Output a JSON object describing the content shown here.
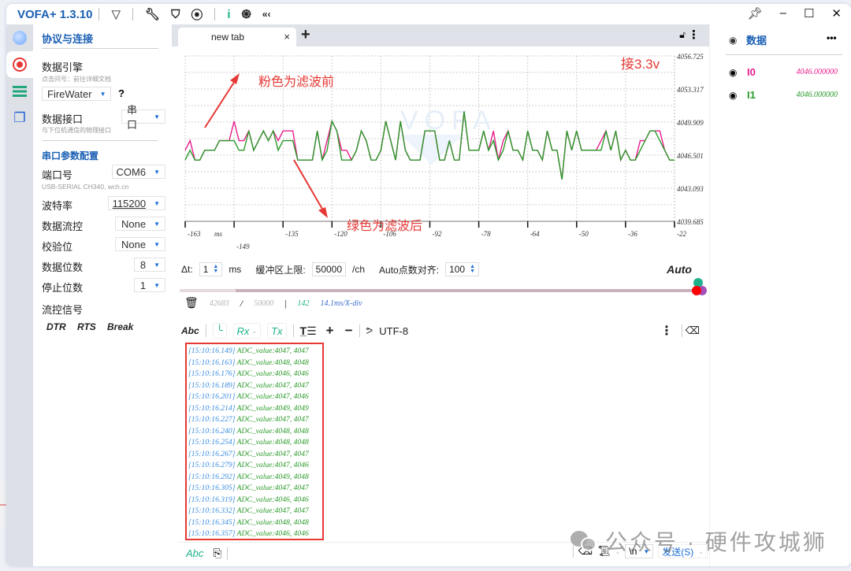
{
  "app": {
    "title": "VOFA+ 1.3.10",
    "toolbar_icons": [
      "vofa-logo-icon",
      "wrench-icon",
      "shirt-icon",
      "camera-icon",
      "info-icon",
      "fingerprint-icon",
      "collapse-icon"
    ],
    "window_controls": {
      "pin": "✈",
      "minimize": "–",
      "maximize": "☐",
      "close": "✕"
    }
  },
  "sidebar": {
    "section_title": "协议与连接",
    "engine_label": "数据引擎",
    "engine_hint": "点击问号：前往详细文档",
    "engine_value": "FireWater",
    "engine_help": "?",
    "interface_label": "数据接口",
    "interface_value": "串口",
    "interface_hint": "与下位机通信的物理接口",
    "serial_title": "串口参数配置",
    "port_label": "端口号",
    "port_value": "COM6",
    "port_hint": "USB-SERIAL CH340, wch.cn",
    "baud_label": "波特率",
    "baud_value": "115200",
    "flow_label": "数据流控",
    "flow_value": "None",
    "parity_label": "校验位",
    "parity_value": "None",
    "databits_label": "数据位数",
    "databits_value": "8",
    "stopbits_label": "停止位数",
    "stopbits_value": "1",
    "signals_label": "流控信号",
    "signals": [
      "DTR",
      "RTS",
      "Break"
    ]
  },
  "tabs": {
    "items": [
      {
        "label": "new tab"
      }
    ],
    "close": "×",
    "add": "+"
  },
  "chart_data": {
    "type": "line",
    "title": "",
    "xlabel": "ms",
    "ylabel": "",
    "ylim": [
      4039.685,
      4056.725
    ],
    "xlim": [
      -163,
      -20
    ],
    "grid": true,
    "ytick_labels": [
      "4056.725",
      "4053.317",
      "4049.909",
      "4046.501",
      "4043.093",
      "4039.685"
    ],
    "xtick_labels": [
      "-163",
      "-149",
      "-135",
      "-120",
      "-106",
      "-92",
      "-78",
      "-64",
      "-50",
      "-36",
      "-22"
    ],
    "series": [
      {
        "name": "I0",
        "color": "#e91e8c",
        "values": [
          4047,
          4048,
          4046,
          4046,
          4047,
          4047,
          4047,
          4048,
          4048,
          4048,
          4050,
          4048,
          4048,
          4049,
          4047,
          4048,
          4049,
          4048,
          4049,
          4048,
          4049,
          4049,
          4049,
          4046,
          4046,
          4046,
          4046,
          4049,
          4046,
          4048,
          4050,
          4049,
          4047,
          4047,
          4046,
          4047,
          4049,
          4048,
          4046,
          4046,
          4047,
          4050,
          4048,
          4046,
          4050,
          4047,
          4046,
          4046,
          4046,
          4049,
          4049,
          4049,
          4046,
          4046,
          4048,
          4046,
          4046,
          4051,
          4047,
          4047,
          4047,
          4049,
          4047,
          4049,
          4046,
          4048,
          4049,
          4047,
          4047,
          4046,
          4049,
          4047,
          4047,
          4046,
          4049,
          4047,
          4047,
          4044,
          4049,
          4047,
          4049,
          4047,
          4047,
          4047,
          4047,
          4048,
          4049,
          4047,
          4049,
          4046,
          4047,
          4046,
          4046,
          4048,
          4048,
          4049,
          4049,
          4049,
          4047,
          4046,
          4046
        ]
      },
      {
        "name": "I1",
        "color": "#2a9a2a",
        "values": [
          4046,
          4047,
          4046,
          4046,
          4047,
          4047,
          4047,
          4048,
          4048,
          4048,
          4048,
          4047,
          4047,
          4049,
          4047,
          4048,
          4049,
          4048,
          4049,
          4047,
          4048,
          4048,
          4048,
          4046,
          4046,
          4046,
          4046,
          4049,
          4046,
          4047,
          4050,
          4049,
          4046,
          4046,
          4046,
          4047,
          4049,
          4048,
          4046,
          4046,
          4047,
          4050,
          4048,
          4046,
          4050,
          4047,
          4046,
          4046,
          4046,
          4049,
          4049,
          4049,
          4046,
          4046,
          4048,
          4046,
          4046,
          4051,
          4047,
          4047,
          4047,
          4049,
          4047,
          4048,
          4046,
          4047,
          4049,
          4047,
          4047,
          4046,
          4049,
          4047,
          4047,
          4046,
          4049,
          4047,
          4047,
          4044,
          4049,
          4047,
          4049,
          4047,
          4047,
          4047,
          4047,
          4047,
          4049,
          4047,
          4049,
          4046,
          4047,
          4046,
          4046,
          4047,
          4048,
          4049,
          4049,
          4048,
          4047,
          4046,
          4046
        ]
      }
    ],
    "annotations": [
      "粉色为滤波前",
      "绿色为滤波后",
      "接3.3v"
    ],
    "watermark": "VOFA"
  },
  "controls": {
    "dt_label": "Δt:",
    "dt_value": "1",
    "dt_unit": "ms",
    "buffer_label": "缓冲区上限:",
    "buffer_value": "50000",
    "buffer_unit": "/ch",
    "align_label": "Auto点数对齐:",
    "align_value": "100",
    "auto_label": "Auto",
    "slider_fraction": 1.0
  },
  "stats": {
    "count": "42683",
    "slash": "/",
    "max": "50000",
    "bar": "|",
    "points": "142",
    "per_div": "14.1ms/X-div"
  },
  "console_toolbar": {
    "abc": "Abc",
    "rx": "Rx",
    "tx": "Tx",
    "encoding": "UTF-8"
  },
  "log": [
    {
      "ts": "[15:10:16.149]",
      "msg": "ADC_value:4047, 4047"
    },
    {
      "ts": "[15:10:16.163]",
      "msg": "ADC_value:4048, 4048"
    },
    {
      "ts": "[15:10:16.176]",
      "msg": "ADC_value:4046, 4046"
    },
    {
      "ts": "[15:10:16.189]",
      "msg": "ADC_value:4047, 4047"
    },
    {
      "ts": "[15:10:16.201]",
      "msg": "ADC_value:4047, 4046"
    },
    {
      "ts": "[15:10:16.214]",
      "msg": "ADC_value:4049, 4049"
    },
    {
      "ts": "[15:10:16.227]",
      "msg": "ADC_value:4047, 4047"
    },
    {
      "ts": "[15:10:16.240]",
      "msg": "ADC_value:4048, 4048"
    },
    {
      "ts": "[15:10:16.254]",
      "msg": "ADC_value:4048, 4048"
    },
    {
      "ts": "[15:10:16.267]",
      "msg": "ADC_value:4047, 4047"
    },
    {
      "ts": "[15:10:16.279]",
      "msg": "ADC_value:4047, 4046"
    },
    {
      "ts": "[15:10:16.292]",
      "msg": "ADC_value:4049, 4048"
    },
    {
      "ts": "[15:10:16.305]",
      "msg": "ADC_value:4047, 4047"
    },
    {
      "ts": "[15:10:16.319]",
      "msg": "ADC_value:4046, 4046"
    },
    {
      "ts": "[15:10:16.332]",
      "msg": "ADC_value:4047, 4047"
    },
    {
      "ts": "[15:10:16.345]",
      "msg": "ADC_value:4048, 4048"
    },
    {
      "ts": "[15:10:16.357]",
      "msg": "ADC_value:4046, 4046"
    }
  ],
  "send_bar": {
    "abc": "Abc",
    "newline": "\\n",
    "send_label": "发送(S)"
  },
  "data_panel": {
    "title": "数据",
    "more": "•••",
    "channels": [
      {
        "name": "I0",
        "value": "4046.000000",
        "color": "#e91e8c"
      },
      {
        "name": "I1",
        "value": "4046.000000",
        "color": "#2a9a2a"
      }
    ]
  },
  "watermark": "公众号 · 硬件攻城狮",
  "colors": {
    "accent": "#1a5fb4",
    "teal": "#1fb28a",
    "annotation": "#e53935"
  }
}
